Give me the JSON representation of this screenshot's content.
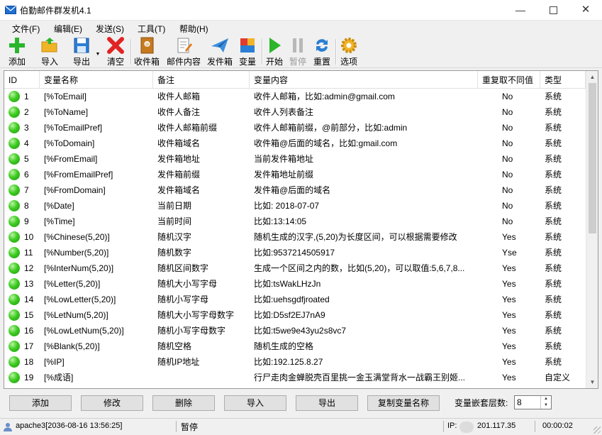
{
  "window": {
    "title": "伯勤邮件群发机4.1",
    "min": "—",
    "close": "✕"
  },
  "menu": [
    "文件(F)",
    "编辑(E)",
    "发送(S)",
    "工具(T)",
    "帮助(H)"
  ],
  "toolbar": {
    "add": "添加",
    "import": "导入",
    "export": "导出",
    "clear": "清空",
    "outbox": "收件箱",
    "mail_content": "邮件内容",
    "send_box": "发件箱",
    "variable": "变量",
    "start": "开始",
    "pause": "暂停",
    "reset": "重置",
    "options": "选项"
  },
  "grid": {
    "columns": [
      "ID",
      "变量名称",
      "备注",
      "变量内容",
      "重复取不同值",
      "类型"
    ],
    "rows": [
      {
        "id": "1",
        "name": "[%ToEmail]",
        "note": "收件人邮箱",
        "content": "收件人邮箱，比如:admin@gmail.com",
        "repeat": "No",
        "type": "系统"
      },
      {
        "id": "2",
        "name": "[%ToName]",
        "note": "收件人备注",
        "content": "收件人列表备注",
        "repeat": "No",
        "type": "系统"
      },
      {
        "id": "3",
        "name": "[%ToEmailPref]",
        "note": "收件人邮箱前缀",
        "content": "收件人邮箱前缀，@前部分，比如:admin",
        "repeat": "No",
        "type": "系统"
      },
      {
        "id": "4",
        "name": "[%ToDomain]",
        "note": "收件箱域名",
        "content": "收件箱@后面的域名，比如:gmail.com",
        "repeat": "No",
        "type": "系统"
      },
      {
        "id": "5",
        "name": "[%FromEmail]",
        "note": "发件箱地址",
        "content": "当前发件箱地址",
        "repeat": "No",
        "type": "系统"
      },
      {
        "id": "6",
        "name": "[%FromEmailPref]",
        "note": "发件箱前缀",
        "content": "发件箱地址前缀",
        "repeat": "No",
        "type": "系统"
      },
      {
        "id": "7",
        "name": "[%FromDomain]",
        "note": "发件箱域名",
        "content": "发件箱@后面的域名",
        "repeat": "No",
        "type": "系统"
      },
      {
        "id": "8",
        "name": "[%Date]",
        "note": "当前日期",
        "content": "比如: 2018-07-07",
        "repeat": "No",
        "type": "系统"
      },
      {
        "id": "9",
        "name": "[%Time]",
        "note": "当前时间",
        "content": "比如:13:14:05",
        "repeat": "No",
        "type": "系统"
      },
      {
        "id": "10",
        "name": "[%Chinese(5,20)]",
        "note": "随机汉字",
        "content": "随机生成的汉字,(5,20)为长度区间，可以根据需要修改",
        "repeat": "Yes",
        "type": "系统"
      },
      {
        "id": "11",
        "name": "[%Number(5,20)]",
        "note": "随机数字",
        "content": "比如:9537214505917",
        "repeat": "Yse",
        "type": "系统"
      },
      {
        "id": "12",
        "name": "[%InterNum(5,20)]",
        "note": "随机区间数字",
        "content": "生成一个区间之内的数，比如(5,20)，可以取值:5,6,7,8...",
        "repeat": "Yes",
        "type": "系统"
      },
      {
        "id": "13",
        "name": "[%Letter(5,20)]",
        "note": "随机大小写字母",
        "content": "比如:tsWakLHzJn",
        "repeat": "Yes",
        "type": "系统"
      },
      {
        "id": "14",
        "name": "[%LowLetter(5,20)]",
        "note": "随机小写字母",
        "content": "比如:uehsgdfjroated",
        "repeat": "Yes",
        "type": "系统"
      },
      {
        "id": "15",
        "name": "[%LetNum(5,20)]",
        "note": "随机大小写字母数字",
        "content": "比如:D5sf2EJ7nA9",
        "repeat": "Yes",
        "type": "系统"
      },
      {
        "id": "16",
        "name": "[%LowLetNum(5,20)]",
        "note": "随机小写字母数字",
        "content": "比如:t5we9e43yu2s8vc7",
        "repeat": "Yes",
        "type": "系统"
      },
      {
        "id": "17",
        "name": "[%Blank(5,20)]",
        "note": "随机空格",
        "content": "随机生成的空格",
        "repeat": "Yes",
        "type": "系统"
      },
      {
        "id": "18",
        "name": "[%IP]",
        "note": "随机IP地址",
        "content": "比如:192.125.8.27",
        "repeat": "Yes",
        "type": "系统"
      },
      {
        "id": "19",
        "name": "[%成语]",
        "note": "",
        "content": "行尸走肉金蝉脱壳百里挑一金玉满堂背水一战霸王别姬...",
        "repeat": "Yes",
        "type": "自定义"
      }
    ]
  },
  "buttons": {
    "add": "添加",
    "edit": "修改",
    "delete": "删除",
    "import": "导入",
    "export": "导出",
    "copy_name": "复制变量名称"
  },
  "depth": {
    "label": "变量嵌套层数:",
    "value": "8"
  },
  "status": {
    "user": "apache3[2036-08-16 13:56:25]",
    "state": "暂停",
    "ip_label": "IP:",
    "ip": "201.117.35",
    "timer": "00:00:02"
  },
  "colors": {
    "status_dot": "#3fcc22",
    "start_green": "#2bb52b",
    "clear_red": "#e02424"
  }
}
